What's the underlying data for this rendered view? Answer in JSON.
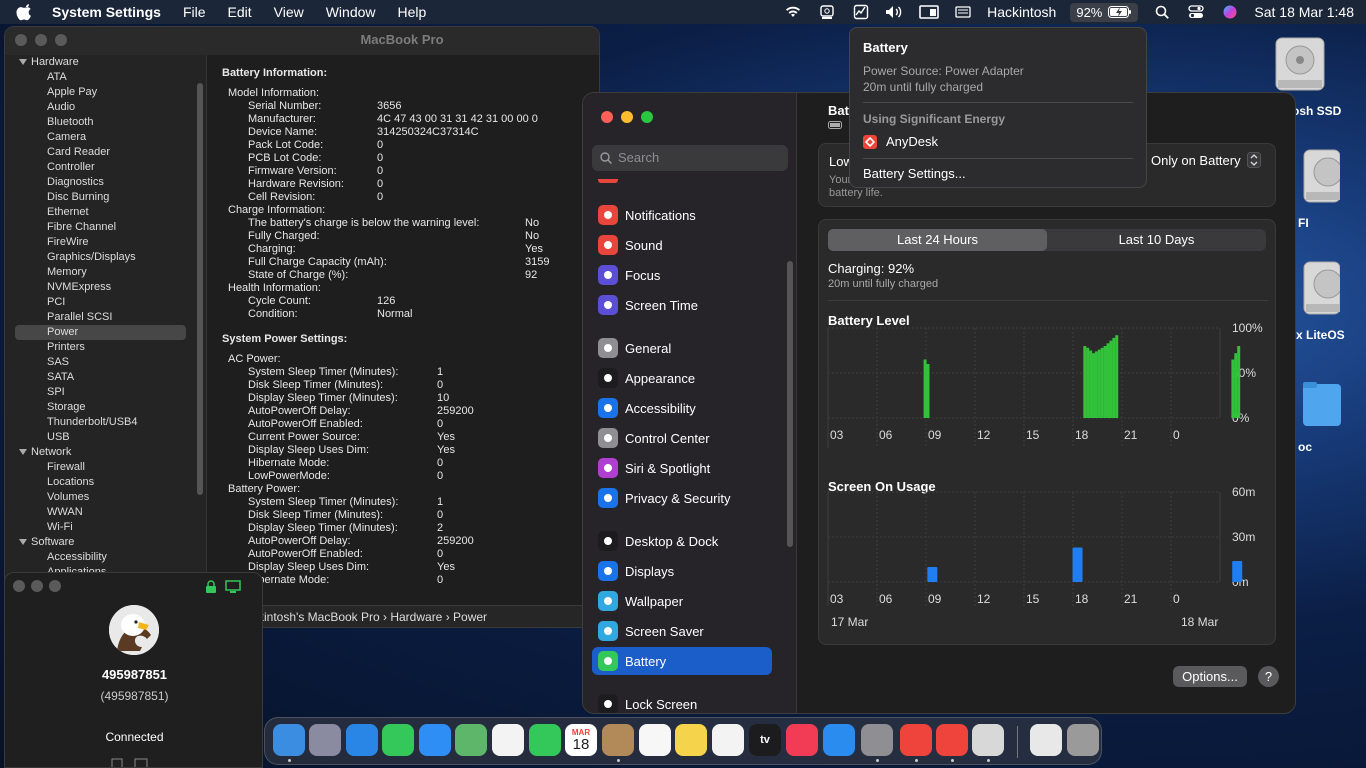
{
  "menubar": {
    "app": "System Settings",
    "items": [
      "File",
      "Edit",
      "View",
      "Window",
      "Help"
    ],
    "host": "Hackintosh",
    "battery_pct": "92%",
    "datetime": "Sat 18 Mar  1:48"
  },
  "desktop": {
    "icons": [
      "osh SSD",
      "FI",
      "x LiteOS",
      "oc"
    ]
  },
  "sysinfo": {
    "title": "MacBook Pro",
    "sidebar": [
      {
        "label": "Hardware",
        "group": true
      },
      {
        "label": "ATA"
      },
      {
        "label": "Apple Pay"
      },
      {
        "label": "Audio"
      },
      {
        "label": "Bluetooth"
      },
      {
        "label": "Camera"
      },
      {
        "label": "Card Reader"
      },
      {
        "label": "Controller"
      },
      {
        "label": "Diagnostics"
      },
      {
        "label": "Disc Burning"
      },
      {
        "label": "Ethernet"
      },
      {
        "label": "Fibre Channel"
      },
      {
        "label": "FireWire"
      },
      {
        "label": "Graphics/Displays"
      },
      {
        "label": "Memory"
      },
      {
        "label": "NVMExpress"
      },
      {
        "label": "PCI"
      },
      {
        "label": "Parallel SCSI"
      },
      {
        "label": "Power",
        "selected": true
      },
      {
        "label": "Printers"
      },
      {
        "label": "SAS"
      },
      {
        "label": "SATA"
      },
      {
        "label": "SPI"
      },
      {
        "label": "Storage"
      },
      {
        "label": "Thunderbolt/USB4"
      },
      {
        "label": "USB"
      },
      {
        "label": "Network",
        "group": true
      },
      {
        "label": "Firewall"
      },
      {
        "label": "Locations"
      },
      {
        "label": "Volumes"
      },
      {
        "label": "WWAN"
      },
      {
        "label": "Wi-Fi"
      },
      {
        "label": "Software",
        "group": true
      },
      {
        "label": "Accessibility"
      },
      {
        "label": "Applications"
      }
    ],
    "battery_heading": "Battery Information:",
    "battery_rows": [
      {
        "k": "Model Information:",
        "v": "",
        "i": 0
      },
      {
        "k": "Serial Number:",
        "v": "3656",
        "i": 1
      },
      {
        "k": "Manufacturer:",
        "v": "4C 47 43 00 31 31 42 31 00 00 0",
        "i": 1
      },
      {
        "k": "Device Name:",
        "v": "314250324C37314C",
        "i": 1
      },
      {
        "k": "Pack Lot Code:",
        "v": "0",
        "i": 1
      },
      {
        "k": "PCB Lot Code:",
        "v": "0",
        "i": 1
      },
      {
        "k": "Firmware Version:",
        "v": "0",
        "i": 1
      },
      {
        "k": "Hardware Revision:",
        "v": "0",
        "i": 1
      },
      {
        "k": "Cell Revision:",
        "v": "0",
        "i": 1
      },
      {
        "k": "Charge Information:",
        "v": "",
        "i": 0
      },
      {
        "k": "The battery's charge is below the warning level:",
        "v": "No",
        "i": 2
      },
      {
        "k": "Fully Charged:",
        "v": "No",
        "i": 2
      },
      {
        "k": "Charging:",
        "v": "Yes",
        "i": 2
      },
      {
        "k": "Full Charge Capacity (mAh):",
        "v": "3159",
        "i": 2
      },
      {
        "k": "State of Charge (%):",
        "v": "92",
        "i": 2
      },
      {
        "k": "Health Information:",
        "v": "",
        "i": 0
      },
      {
        "k": "Cycle Count:",
        "v": "126",
        "i": 1
      },
      {
        "k": "Condition:",
        "v": "Normal",
        "i": 1
      }
    ],
    "power_heading": "System Power Settings:",
    "power_rows": [
      {
        "k": "AC Power:",
        "v": "",
        "i": 0
      },
      {
        "k": "System Sleep Timer (Minutes):",
        "v": "1",
        "i": 1
      },
      {
        "k": "Disk Sleep Timer (Minutes):",
        "v": "0",
        "i": 1
      },
      {
        "k": "Display Sleep Timer (Minutes):",
        "v": "10",
        "i": 1
      },
      {
        "k": "AutoPowerOff Delay:",
        "v": "259200",
        "i": 1
      },
      {
        "k": "AutoPowerOff Enabled:",
        "v": "0",
        "i": 1
      },
      {
        "k": "Current Power Source:",
        "v": "Yes",
        "i": 1
      },
      {
        "k": "Display Sleep Uses Dim:",
        "v": "Yes",
        "i": 1
      },
      {
        "k": "Hibernate Mode:",
        "v": "0",
        "i": 1
      },
      {
        "k": "LowPowerMode:",
        "v": "0",
        "i": 1
      },
      {
        "k": "Battery Power:",
        "v": "",
        "i": 0
      },
      {
        "k": "System Sleep Timer (Minutes):",
        "v": "1",
        "i": 1
      },
      {
        "k": "Disk Sleep Timer (Minutes):",
        "v": "0",
        "i": 1
      },
      {
        "k": "Display Sleep Timer (Minutes):",
        "v": "2",
        "i": 1
      },
      {
        "k": "AutoPowerOff Delay:",
        "v": "259200",
        "i": 1
      },
      {
        "k": "AutoPowerOff Enabled:",
        "v": "0",
        "i": 1
      },
      {
        "k": "Display Sleep Uses Dim:",
        "v": "Yes",
        "i": 1
      },
      {
        "k": "Hibernate Mode:",
        "v": "0",
        "i": 1
      }
    ],
    "path": "kintosh's MacBook Pro › Hardware  › Power"
  },
  "anydesk": {
    "id": "495987851",
    "id_paren": "(495987851)",
    "status": "Connected"
  },
  "settings": {
    "search_placeholder": "Search",
    "nav": [
      {
        "label": "Notifications",
        "color": "#e8453c",
        "icon": "bell-icon"
      },
      {
        "label": "Sound",
        "color": "#e8453c",
        "icon": "speaker-icon"
      },
      {
        "label": "Focus",
        "color": "#5b4fd6",
        "icon": "moon-icon"
      },
      {
        "label": "Screen Time",
        "color": "#5b4fd6",
        "icon": "hourglass-icon"
      },
      {
        "label": "General",
        "color": "#8e8e93",
        "icon": "gear-icon"
      },
      {
        "label": "Appearance",
        "color": "#1c1c1e",
        "icon": "appearance-icon"
      },
      {
        "label": "Accessibility",
        "color": "#1a73e8",
        "icon": "accessibility-icon"
      },
      {
        "label": "Control Center",
        "color": "#8e8e93",
        "icon": "toggles-icon"
      },
      {
        "label": "Siri & Spotlight",
        "color": "#b03fd1",
        "icon": "siri-icon"
      },
      {
        "label": "Privacy & Security",
        "color": "#1a73e8",
        "icon": "hand-icon"
      },
      {
        "label": "Desktop & Dock",
        "color": "#1c1c1e",
        "icon": "dock-icon"
      },
      {
        "label": "Displays",
        "color": "#1a73e8",
        "icon": "sun-icon"
      },
      {
        "label": "Wallpaper",
        "color": "#31a8e0",
        "icon": "flower-icon"
      },
      {
        "label": "Screen Saver",
        "color": "#31a8e0",
        "icon": "screensaver-icon"
      },
      {
        "label": "Battery",
        "color": "#34c759",
        "icon": "battery-icon",
        "active": true
      },
      {
        "label": "Lock Screen",
        "color": "#1c1c1e",
        "icon": "lock-icon"
      }
    ],
    "header": "Batt",
    "low_power_label": "Low",
    "low_power_desc1": "Your",
    "low_power_desc2": "battery life.",
    "low_power_value": "Only on Battery",
    "tab_24h": "Last 24 Hours",
    "tab_10d": "Last 10 Days",
    "charging": "Charging: 92%",
    "charging_sub": "20m until fully charged",
    "battery_level_title": "Battery Level",
    "screen_on_title": "Screen On Usage",
    "date_left": "17 Mar",
    "date_right": "18 Mar",
    "options_label": "Options...",
    "help_label": "?"
  },
  "popup": {
    "title": "Battery",
    "source": "Power Source: Power Adapter",
    "until": "20m until fully charged",
    "energy_heading": "Using Significant Energy",
    "app": "AnyDesk",
    "settings_link": "Battery Settings..."
  },
  "chart_data": [
    {
      "type": "bar",
      "title": "Battery Level",
      "x_ticks": [
        "03",
        "06",
        "09",
        "12",
        "15",
        "18",
        "21",
        "0"
      ],
      "y_ticks": [
        "100%",
        "50%",
        "0%"
      ],
      "ylim": [
        0,
        100
      ],
      "x_range": [
        0,
        24
      ],
      "series": [
        {
          "values": [
            [
              5.0,
              65
            ],
            [
              5.2,
              60
            ],
            [
              16.0,
              80
            ],
            [
              16.2,
              78
            ],
            [
              16.4,
              75
            ],
            [
              16.6,
              72
            ],
            [
              16.8,
              74
            ],
            [
              17.0,
              76
            ],
            [
              17.2,
              78
            ],
            [
              17.4,
              80
            ],
            [
              17.6,
              83
            ],
            [
              17.8,
              86
            ],
            [
              18.0,
              89
            ],
            [
              18.2,
              92
            ],
            [
              26.2,
              65
            ],
            [
              26.4,
              72
            ],
            [
              26.6,
              80
            ]
          ]
        }
      ]
    },
    {
      "type": "bar",
      "title": "Screen On Usage",
      "x_ticks": [
        "03",
        "06",
        "09",
        "12",
        "15",
        "18",
        "21",
        "0"
      ],
      "y_ticks": [
        "60m",
        "30m",
        "0m"
      ],
      "ylim": [
        0,
        60
      ],
      "x_range": [
        0,
        24
      ],
      "series": [
        {
          "values": [
            [
              5.5,
              10
            ],
            [
              15.5,
              23
            ],
            [
              26.5,
              14
            ]
          ]
        }
      ]
    }
  ],
  "dock": {
    "apps": [
      {
        "name": "finder-icon",
        "color": "#3a8de0"
      },
      {
        "name": "launchpad-icon",
        "color": "#8a8aa0"
      },
      {
        "name": "safari-icon",
        "color": "#2a86e6"
      },
      {
        "name": "messages-icon",
        "color": "#34c759"
      },
      {
        "name": "mail-icon",
        "color": "#2f8ef5"
      },
      {
        "name": "maps-icon",
        "color": "#5db66a"
      },
      {
        "name": "photos-icon",
        "color": "#f3f3f3"
      },
      {
        "name": "facetime-icon",
        "color": "#34c759"
      },
      {
        "name": "calendar-icon",
        "color": "#ffffff"
      },
      {
        "name": "contacts-icon",
        "color": "#b28a5a"
      },
      {
        "name": "reminders-icon",
        "color": "#f7f7f7"
      },
      {
        "name": "notes-icon",
        "color": "#f5d44c"
      },
      {
        "name": "freeform-icon",
        "color": "#f3f3f3"
      },
      {
        "name": "tv-icon",
        "color": "#1c1c1e"
      },
      {
        "name": "music-icon",
        "color": "#f23c55"
      },
      {
        "name": "appstore-icon",
        "color": "#2b8cf0"
      },
      {
        "name": "systemsettings-icon",
        "color": "#8e8e93"
      },
      {
        "name": "anydesk-icon",
        "color": "#ef443b"
      },
      {
        "name": "anydesk2-icon",
        "color": "#ef443b"
      },
      {
        "name": "sysinfo-icon",
        "color": "#d8d8d8"
      },
      {
        "name": "document-icon",
        "color": "#e8e8e8"
      },
      {
        "name": "trash-icon",
        "color": "#9a9a9a"
      }
    ],
    "calendar_month": "MAR",
    "calendar_day": "18",
    "tv_label": "tv"
  }
}
